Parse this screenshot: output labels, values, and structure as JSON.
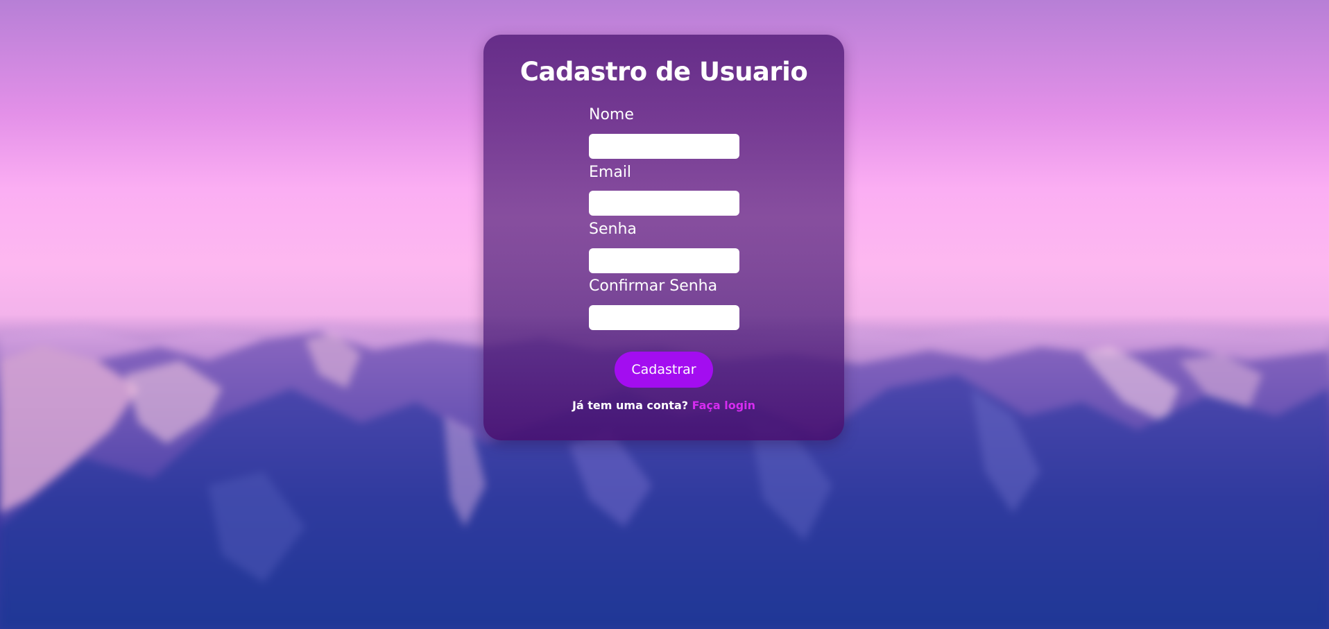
{
  "colors": {
    "accent": "#a30df0",
    "link": "#d62cf0",
    "card": "#5c2480"
  },
  "background": {
    "image": "mountain-landscape-image"
  },
  "form": {
    "title": "Cadastro de Usuario",
    "fields": [
      {
        "label": "Nome",
        "value": "",
        "placeholder": ""
      },
      {
        "label": "Email",
        "value": "",
        "placeholder": ""
      },
      {
        "label": "Senha",
        "value": "",
        "placeholder": ""
      },
      {
        "label": "Confirmar Senha",
        "value": "",
        "placeholder": ""
      }
    ],
    "submit_label": "Cadastrar",
    "footer_text": "Já tem uma conta?",
    "login_link": "Faça login"
  }
}
